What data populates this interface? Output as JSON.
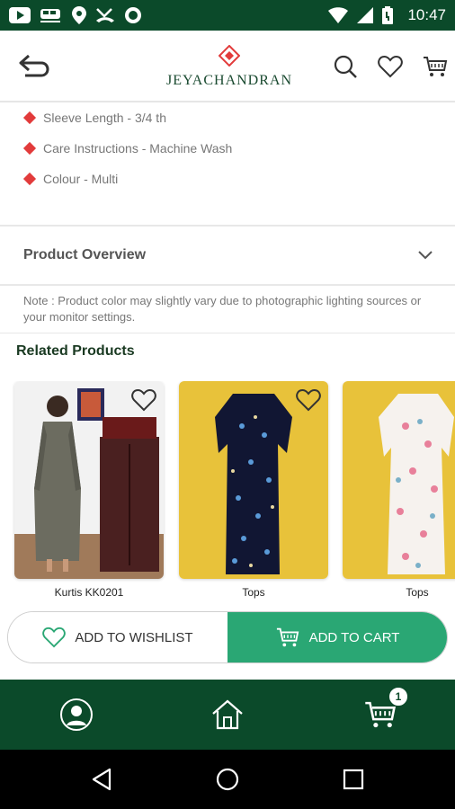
{
  "status_bar": {
    "time": "10:47",
    "icons": [
      "youtube-icon",
      "train-icon",
      "location-icon",
      "missed-call-icon",
      "record-icon",
      "wifi-icon",
      "signal-icon",
      "battery-icon"
    ]
  },
  "header": {
    "brand": "JEYACHANDRAN",
    "icons": [
      "back-arrow-icon",
      "search-icon",
      "heart-icon",
      "cart-icon"
    ]
  },
  "details": {
    "bullets": [
      "Sleeve Length - 3/4 th",
      "Care Instructions - Machine Wash",
      "Colour -  Multi"
    ]
  },
  "overview": {
    "title": "Product Overview"
  },
  "note": "Note : Product color may slightly vary due to photographic lighting sources or your monitor settings.",
  "related": {
    "title": "Related Products",
    "products": [
      {
        "name": "Kurtis KK0201"
      },
      {
        "name": "Tops"
      },
      {
        "name": "Tops"
      }
    ]
  },
  "actions": {
    "wishlist_label": "ADD TO WISHLIST",
    "cart_label": "ADD TO CART"
  },
  "bottom_nav": {
    "cart_count": "1"
  },
  "colors": {
    "brand_green": "#0b4a2a",
    "cart_green": "#2aa774",
    "bullet_red": "#e23b3b"
  }
}
